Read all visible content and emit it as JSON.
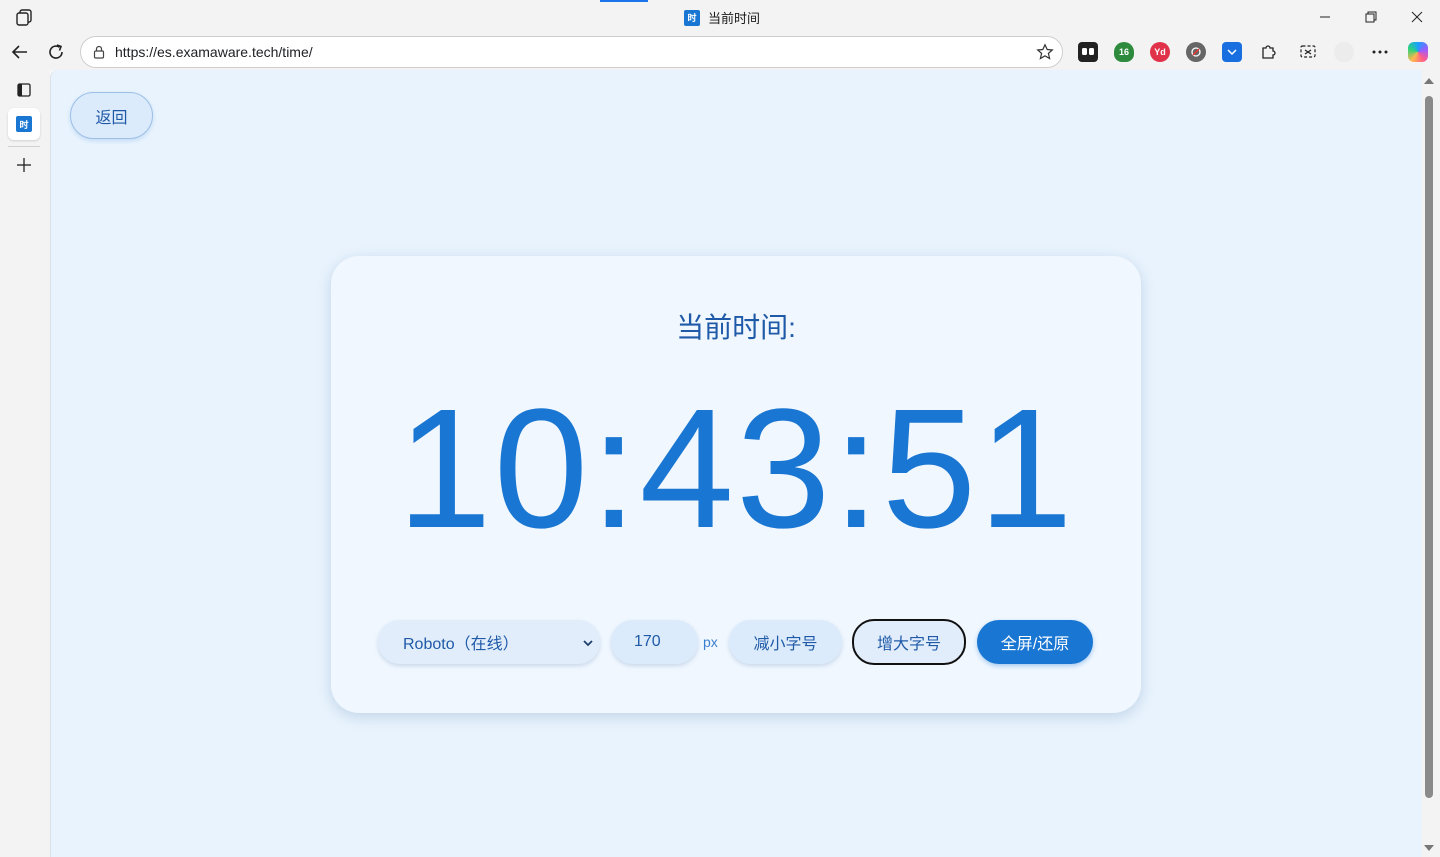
{
  "browser": {
    "tab_title": "当前时间",
    "favicon_text": "时",
    "url": "https://es.examaware.tech/time/",
    "window_controls": [
      "minimize-icon",
      "restore-icon",
      "close-icon"
    ],
    "extensions": [
      {
        "name": "reading-list-icon",
        "color": "#222222",
        "text": ""
      },
      {
        "name": "shield-badge-icon",
        "color": "#2e8b3e",
        "text": "16"
      },
      {
        "name": "red-ext-icon",
        "color": "#e0334a",
        "text": "Yd"
      },
      {
        "name": "blocked-ext-icon",
        "color": "#555555",
        "text": ""
      },
      {
        "name": "blue-ext-icon",
        "color": "#1a6fe0",
        "text": ""
      },
      {
        "name": "extensions-puzzle-icon",
        "color": "#222222",
        "text": ""
      },
      {
        "name": "screenshot-icon",
        "color": "#222222",
        "text": ""
      }
    ]
  },
  "page": {
    "back_label": "返回",
    "heading": "当前时间:",
    "time": "10:43:51",
    "font_select_value": "Roboto（在线）",
    "font_size_value": "170",
    "font_size_unit": "px",
    "decrease_label": "减小字号",
    "increase_label": "增大字号",
    "fullscreen_label": "全屏/还原"
  },
  "colors": {
    "accent": "#1976d2",
    "page_bg": "#e8f3fd",
    "card_bg": "#f0f7ff"
  }
}
